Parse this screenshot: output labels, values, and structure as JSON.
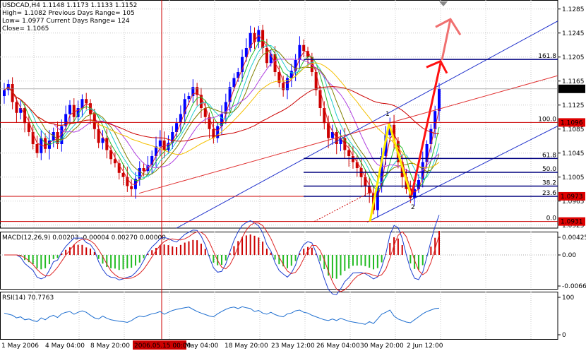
{
  "header": {
    "symbol_line": "USDCAD,H4  1.1148 1.1173 1.1133 1.1152",
    "high_line": "High= 1.1082    Previous Days Range= 105",
    "low_line": "Low= 1.0977    Current Days Range= 124",
    "close_line": "Close= 1.1065"
  },
  "colors": {
    "bull": "#0000ff",
    "bear": "#cc0000",
    "grid": "#c8c8c8",
    "level_line": "#00007f",
    "red_line": "#cc0000",
    "trend_red": "#e03030",
    "trend_blue": "#2233cc",
    "yellow": "#ffee00",
    "arrow_red": "#ff1111",
    "ma_yellow": "#f5c000",
    "ma_purple": "#b040e0",
    "ma_green": "#22bb22",
    "ma_cyan": "#22cccc",
    "ma_olive": "#808000",
    "ma_red": "#dd2222"
  },
  "chart_data": [
    {
      "type": "candlestick",
      "title": "USDCAD,H4",
      "ylim": [
        1.092,
        1.13
      ],
      "yticks": [
        "1.1285",
        "1.1245",
        "1.1205",
        "1.1165",
        "1.1125",
        "1.1085",
        "1.1045",
        "1.1005",
        "1.0965",
        "1.0925"
      ],
      "xlabels": [
        "1 May 2006",
        "4 May 04:00",
        "8 May 20:00",
        "2006.05.15 00:00",
        "May 04:00",
        "18 May 20:00",
        "23 May 12:00",
        "26 May 04:00",
        "30 May 20:00",
        "2 Jun 12:00"
      ],
      "current_price": "1.1152",
      "level_labels": [
        {
          "label": "161.8",
          "price": 1.1201
        },
        {
          "label": "100.0",
          "price": 1.1096
        },
        {
          "label": "61.8",
          "price": 1.1036
        },
        {
          "label": "50.0",
          "price": 1.1013
        },
        {
          "label": "38.2",
          "price": 1.099
        },
        {
          "label": "23.6",
          "price": 1.0973
        },
        {
          "label": "0.0",
          "price": 1.0931
        }
      ],
      "price_boxes": [
        {
          "price": 1.1152,
          "label": "1.1152"
        },
        {
          "price": 1.1096,
          "label": "1.1096"
        },
        {
          "price": 1.0973,
          "label": "1.0973"
        },
        {
          "price": 1.0931,
          "label": "1.0931"
        }
      ],
      "wave_labels": [
        "1",
        "2"
      ],
      "close": [
        1.115,
        1.116,
        1.113,
        1.1112,
        1.112,
        1.1095,
        1.108,
        1.106,
        1.1045,
        1.107,
        1.1052,
        1.1066,
        1.108,
        1.106,
        1.109,
        1.111,
        1.1125,
        1.1105,
        1.112,
        1.1135,
        1.1128,
        1.111,
        1.1085,
        1.1062,
        1.107,
        1.105,
        1.1035,
        1.1028,
        1.1012,
        1.1005,
        1.099,
        1.0985,
        1.1002,
        1.102,
        1.1015,
        1.1025,
        1.104,
        1.1056,
        1.1066,
        1.105,
        1.1062,
        1.108,
        1.1095,
        1.111,
        1.1135,
        1.114,
        1.1155,
        1.1142,
        1.112,
        1.1105,
        1.1085,
        1.107,
        1.109,
        1.111,
        1.113,
        1.1155,
        1.117,
        1.118,
        1.1205,
        1.122,
        1.1245,
        1.123,
        1.125,
        1.122,
        1.1195,
        1.121,
        1.118,
        1.1162,
        1.115,
        1.117,
        1.1182,
        1.12,
        1.1225,
        1.1215,
        1.1205,
        1.118,
        1.115,
        1.112,
        1.1095,
        1.107,
        1.108,
        1.106,
        1.107,
        1.105,
        1.104,
        1.103,
        1.102,
        1.1005,
        1.099,
        1.0978,
        1.095,
        1.099,
        1.104,
        1.1075,
        1.1092,
        1.1065,
        1.103,
        1.1005,
        1.0985,
        1.097,
        1.0985,
        1.1,
        1.103,
        1.106,
        1.1085,
        1.1115,
        1.1152
      ],
      "indicators": [
        {
          "name": "MACD(12,26,9) 0.00203 -0.00004 0.00270 0.00000",
          "yticks": [
            "0.00425",
            "0.00",
            "-0.00661"
          ]
        },
        {
          "name": "RSI(14) 70.7763",
          "yticks": [
            "100",
            "0"
          ]
        }
      ],
      "rsi": [
        58,
        55,
        52,
        45,
        48,
        40,
        42,
        38,
        35,
        45,
        40,
        48,
        52,
        46,
        56,
        60,
        62,
        55,
        60,
        64,
        60,
        52,
        45,
        42,
        50,
        44,
        40,
        38,
        36,
        35,
        33,
        38,
        45,
        50,
        48,
        52,
        56,
        58,
        62,
        55,
        60,
        65,
        68,
        70,
        72,
        74,
        68,
        62,
        58,
        54,
        50,
        48,
        56,
        62,
        68,
        72,
        74,
        70,
        75,
        72,
        70,
        62,
        65,
        58,
        55,
        60,
        54,
        50,
        48,
        56,
        58,
        64,
        66,
        60,
        58,
        52,
        48,
        44,
        40,
        38,
        42,
        38,
        44,
        40,
        36,
        34,
        32,
        30,
        28,
        35,
        30,
        42,
        55,
        60,
        66,
        50,
        42,
        38,
        34,
        32,
        40,
        48,
        56,
        62,
        66,
        70,
        71
      ]
    }
  ]
}
